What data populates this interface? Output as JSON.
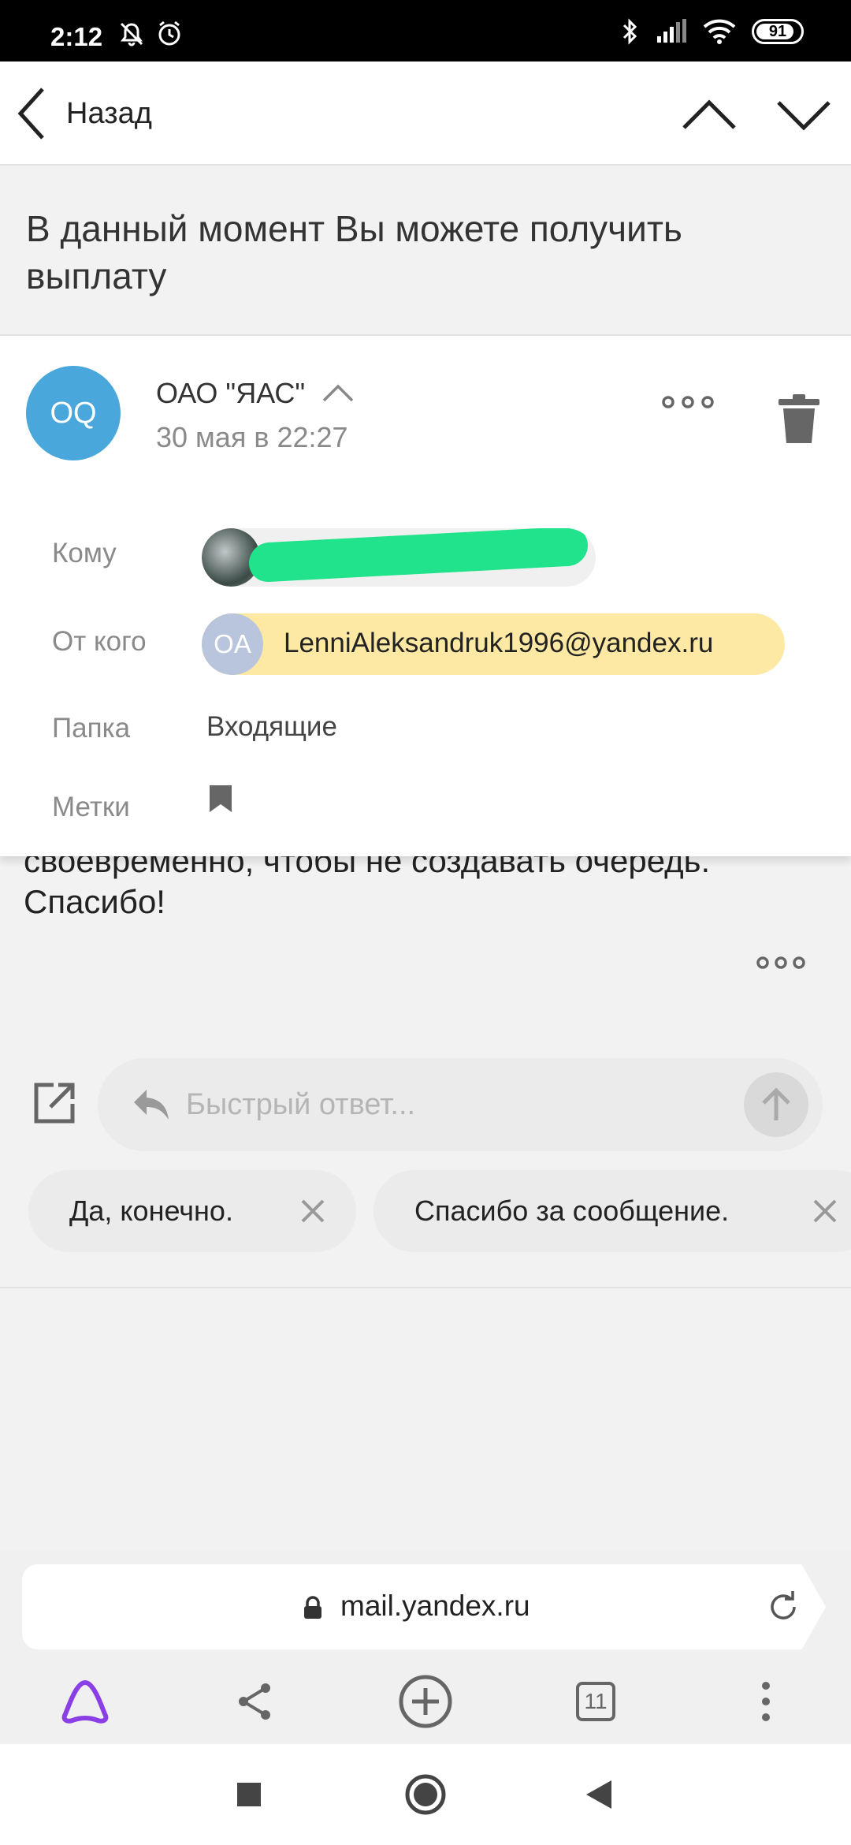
{
  "status_bar": {
    "time": "2:12",
    "battery": "91",
    "icons": [
      "mute-icon",
      "alarm-icon",
      "bluetooth-icon",
      "signal-icon",
      "wifi-icon",
      "battery-icon"
    ]
  },
  "topbar": {
    "back_label": "Назад"
  },
  "message": {
    "subject": "В данный момент Вы можете получить выплату",
    "sender_avatar": "OQ",
    "sender_name": "ОАО \"ЯАС\"",
    "date": "30 мая в 22:27",
    "to_label": "Кому",
    "from_label": "От кого",
    "from_avatar": "OA",
    "from_email": "LenniAleksandruk1996@yandex.ru",
    "folder_label": "Папка",
    "folder_value": "Входящие",
    "tags_label": "Метки",
    "body_line1": "своевременно, чтобы не создавать очередь.",
    "body_line2": "Спасибо!"
  },
  "reply": {
    "placeholder": "Быстрый ответ..."
  },
  "suggestions": [
    "Да, конечно.",
    "Спасибо за сообщение."
  ],
  "browser": {
    "url": "mail.yandex.ru",
    "tabs_count": "11"
  },
  "colors": {
    "avatar_blue": "#4aa7dc",
    "from_chip": "#fde9a3",
    "redaction": "#20e38b",
    "alice_purple": "#8a3ee6"
  }
}
